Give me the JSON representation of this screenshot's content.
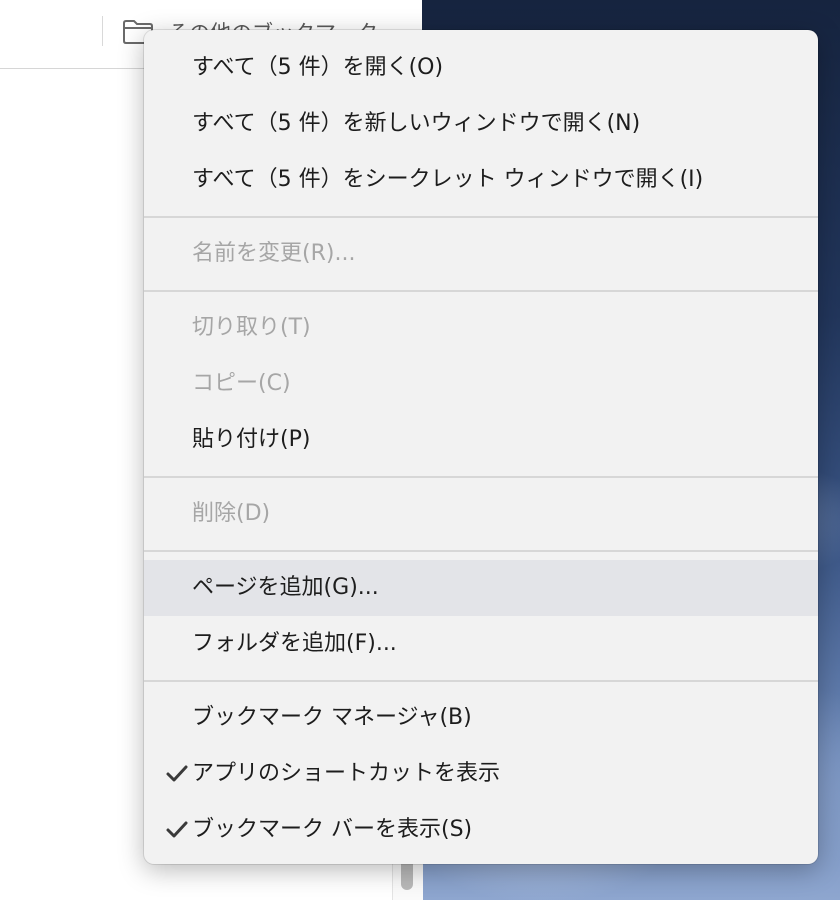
{
  "bookmark_bar": {
    "folder_label": "その他のブックマーク",
    "folder_icon": "folder-icon"
  },
  "context_menu": {
    "items": [
      {
        "id": "open-all",
        "label": "すべて（5 件）を開く(O)",
        "enabled": true
      },
      {
        "id": "open-all-new-window",
        "label": "すべて（5 件）を新しいウィンドウで開く(N)",
        "enabled": true
      },
      {
        "id": "open-all-incognito",
        "label": "すべて（5 件）をシークレット ウィンドウで開く(I)",
        "enabled": true
      },
      {
        "id": "rename",
        "label": "名前を変更(R)...",
        "enabled": false
      },
      {
        "id": "cut",
        "label": "切り取り(T)",
        "enabled": false
      },
      {
        "id": "copy",
        "label": "コピー(C)",
        "enabled": false
      },
      {
        "id": "paste",
        "label": "貼り付け(P)",
        "enabled": true
      },
      {
        "id": "delete",
        "label": "削除(D)",
        "enabled": false
      },
      {
        "id": "add-page",
        "label": "ページを追加(G)...",
        "enabled": true,
        "highlighted": true
      },
      {
        "id": "add-folder",
        "label": "フォルダを追加(F)...",
        "enabled": true
      },
      {
        "id": "bookmark-manager",
        "label": "ブックマーク マネージャ(B)",
        "enabled": true
      },
      {
        "id": "show-apps-shortcut",
        "label": "アプリのショートカットを表示",
        "enabled": true,
        "checked": true
      },
      {
        "id": "show-bookmark-bar",
        "label": "ブックマーク バーを表示(S)",
        "enabled": true,
        "checked": true
      }
    ],
    "colors": {
      "background": "#f2f2f2",
      "text": "#1d1d1d",
      "disabled_text": "#a6a6a6",
      "highlight": "#e3e4e8",
      "separator": "#d7d7d7"
    }
  }
}
